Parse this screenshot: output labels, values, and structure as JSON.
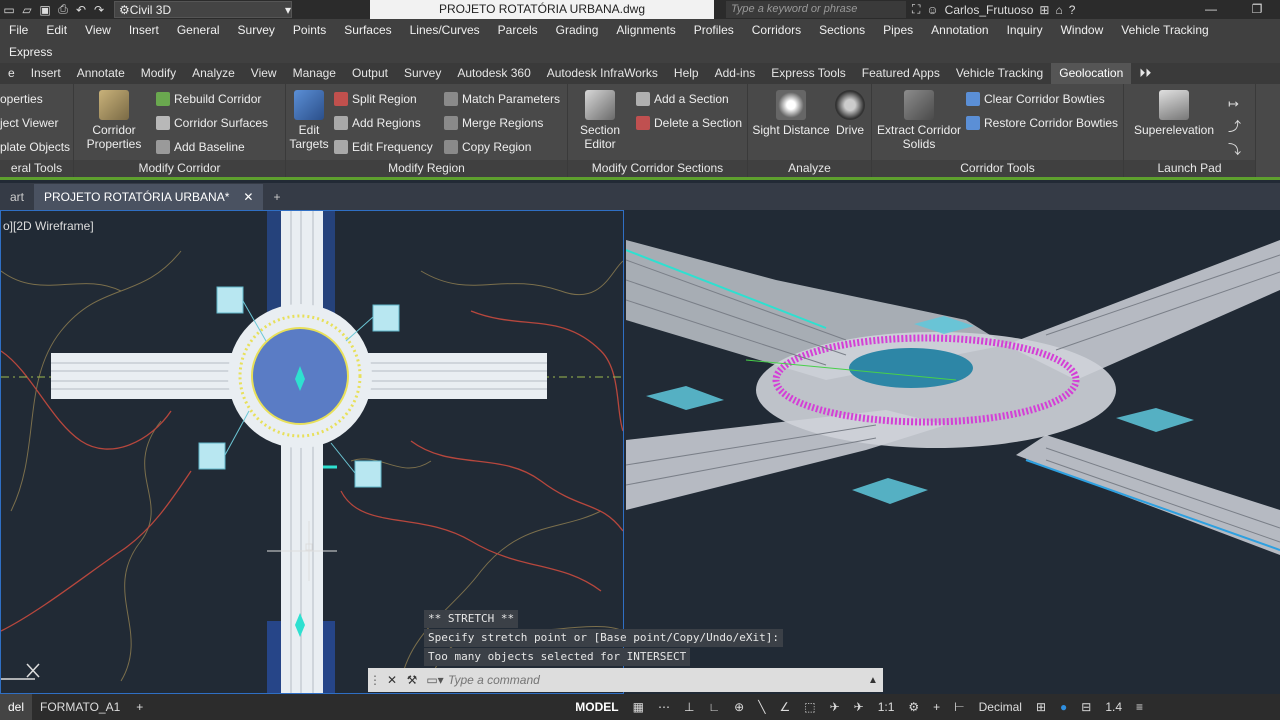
{
  "titlebar": {
    "workspace": "Civil 3D",
    "document": "PROJETO ROTATÓRIA URBANA.dwg",
    "search_placeholder": "Type a keyword or phrase",
    "user": "Carlos_Frutuoso"
  },
  "menubar": {
    "items": [
      "File",
      "Edit",
      "View",
      "Insert",
      "General",
      "Survey",
      "Points",
      "Surfaces",
      "Lines/Curves",
      "Parcels",
      "Grading",
      "Alignments",
      "Profiles",
      "Corridors",
      "Sections",
      "Pipes",
      "Annotation",
      "Inquiry",
      "Window",
      "Vehicle Tracking"
    ],
    "items2": [
      "Express"
    ]
  },
  "tabs": [
    "e",
    "Insert",
    "Annotate",
    "Modify",
    "Analyze",
    "View",
    "Manage",
    "Output",
    "Survey",
    "Autodesk 360",
    "Autodesk InfraWorks",
    "Help",
    "Add-ins",
    "Express Tools",
    "Featured Apps",
    "Vehicle Tracking",
    "Geolocation"
  ],
  "ribbon": {
    "general": {
      "items": [
        "operties",
        "ject Viewer",
        "plate Objects"
      ],
      "title": "eral Tools"
    },
    "modify_corridor": {
      "big": "Corridor Properties",
      "items": [
        "Rebuild Corridor",
        "Corridor Surfaces",
        "Add Baseline"
      ],
      "title": "Modify Corridor"
    },
    "modify_region": {
      "big": "Edit Targets",
      "items": [
        "Split Region",
        "Add Regions",
        "Edit Frequency",
        "Match Parameters",
        "Merge Regions",
        "Copy Region"
      ],
      "title": "Modify Region"
    },
    "sections": {
      "big": "Section Editor",
      "items": [
        "Add a Section",
        "Delete a Section"
      ],
      "title": "Modify Corridor Sections"
    },
    "analyze": {
      "items": [
        "Sight Distance",
        "Drive"
      ],
      "title": "Analyze"
    },
    "tools": {
      "big": "Extract Corridor Solids",
      "items": [
        "Clear Corridor Bowties",
        "Restore Corridor Bowties"
      ],
      "title": "Corridor Tools"
    },
    "launch": {
      "big": "Superelevation",
      "title": "Launch Pad"
    }
  },
  "filetabs": {
    "start": "art",
    "doc": "PROJETO ROTATÓRIA URBANA*"
  },
  "viewport": {
    "label": "o][2D Wireframe]"
  },
  "command": {
    "lines": [
      "** STRETCH **",
      "Specify stretch point or [Base point/Copy/Undo/eXit]:",
      "Too many objects selected for INTERSECT"
    ],
    "placeholder": "Type a command"
  },
  "status": {
    "tabs": [
      "del",
      "FORMATO_A1"
    ],
    "model": "MODEL",
    "scale": "1:1",
    "units": "Decimal",
    "value": "1.4"
  },
  "colors": {
    "accent": "#5ea02e",
    "viewport_border": "#2f6fc4",
    "background": "#212a35"
  }
}
